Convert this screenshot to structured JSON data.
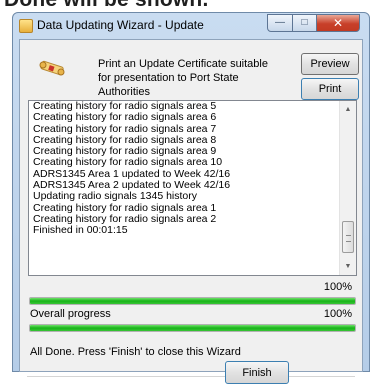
{
  "clipped_heading": "Done will be shown.",
  "window": {
    "title": "Data Updating Wizard - Update",
    "controls": {
      "minimize": "—",
      "maximize": "□",
      "close": "✕"
    }
  },
  "certificate": {
    "text": "Print an Update Certificate suitable for presentation to Port State Authorities",
    "preview_label": "Preview",
    "print_label": "Print",
    "icon": "certificate-scroll-icon"
  },
  "log": {
    "lines": [
      "Creating history for radio signals area 5",
      "Creating history for radio signals area 6",
      "Creating history for radio signals area 7",
      "Creating history for radio signals area 8",
      "Creating history for radio signals area 9",
      "Creating history for radio signals area 10",
      "ADRS1345 Area 1 updated to Week 42/16",
      "ADRS1345 Area 2 updated to Week 42/16",
      "Updating radio signals 1345 history",
      "Creating history for radio signals area 1",
      "Creating history for radio signals area 2",
      "Finished in 00:01:15"
    ]
  },
  "progress": {
    "step_percent_text": "100%",
    "step_value": 1.0,
    "overall_label": "Overall progress",
    "overall_percent_text": "100%",
    "overall_value": 1.0
  },
  "status_text": "All Done. Press 'Finish' to close this Wizard",
  "finish_label": "Finish",
  "colors": {
    "progress_fill": "#18b418",
    "close_button": "#c8402a"
  }
}
